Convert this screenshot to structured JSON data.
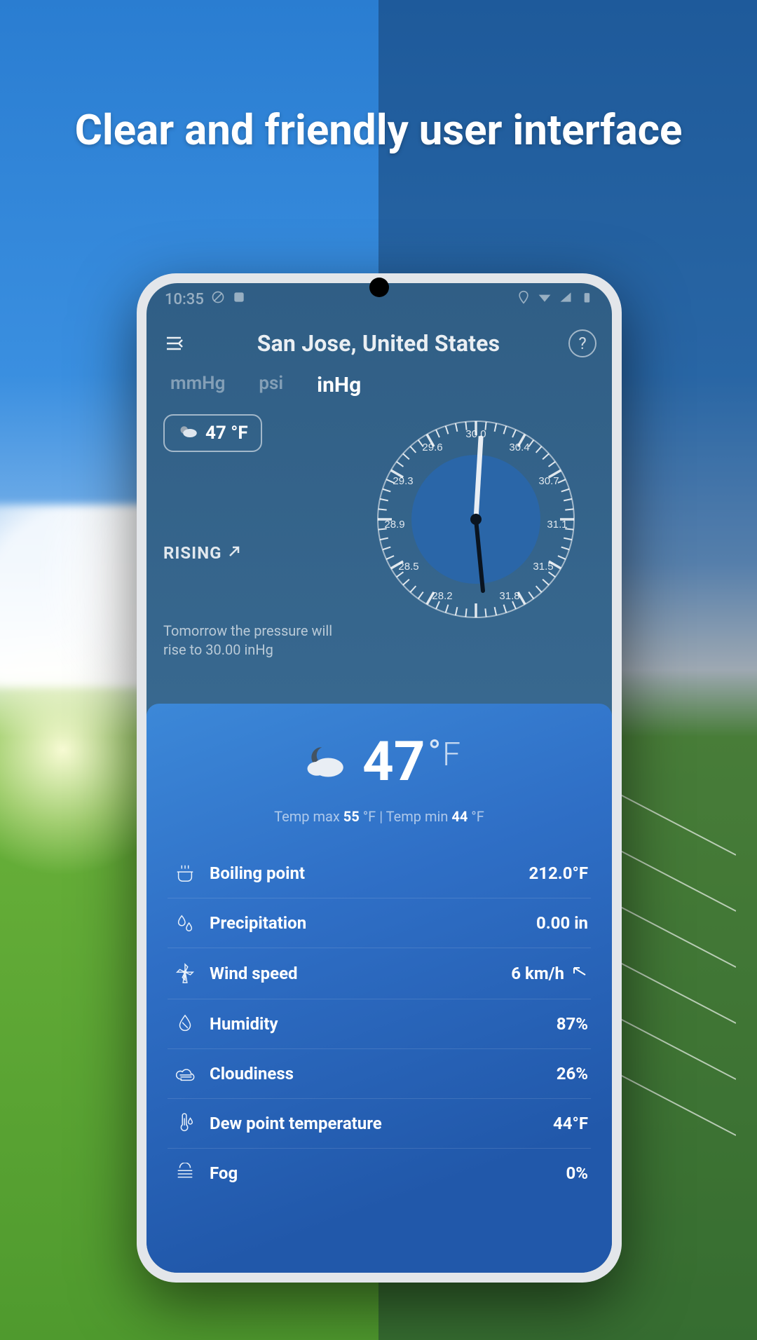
{
  "headline": "Clear and friendly user interface",
  "statusbar": {
    "time": "10:35"
  },
  "header": {
    "location": "San Jose, United States"
  },
  "units": {
    "options": [
      "mmHg",
      "psi",
      "inHg"
    ],
    "active": "inHg"
  },
  "chip": {
    "temp": "47 °F"
  },
  "trend": {
    "label": "RISING"
  },
  "forecast_note": "Tomorrow the pressure will rise to 30.00 inHg",
  "gauge": {
    "ticks": [
      "28.2",
      "28.5",
      "28.9",
      "29.3",
      "29.6",
      "30.0",
      "30.4",
      "30.7",
      "31.1",
      "31.5",
      "31.8"
    ]
  },
  "current": {
    "temp_value": "47",
    "temp_unit": "F"
  },
  "minmax": {
    "prefix_max": "Temp max ",
    "max": "55",
    "max_unit": " °F",
    "sep": " | ",
    "prefix_min": "Temp min ",
    "min": "44",
    "min_unit": " °F"
  },
  "metrics": [
    {
      "key": "boiling",
      "label": "Boiling point",
      "value": "212.0°F"
    },
    {
      "key": "precip",
      "label": "Precipitation",
      "value": "0.00 in"
    },
    {
      "key": "wind",
      "label": "Wind speed",
      "value": "6 km/h",
      "arrow": true
    },
    {
      "key": "humidity",
      "label": "Humidity",
      "value": "87%"
    },
    {
      "key": "cloud",
      "label": "Cloudiness",
      "value": "26%"
    },
    {
      "key": "dewpoint",
      "label": "Dew point temperature",
      "value": "44°F"
    },
    {
      "key": "fog",
      "label": "Fog",
      "value": "0%"
    }
  ]
}
